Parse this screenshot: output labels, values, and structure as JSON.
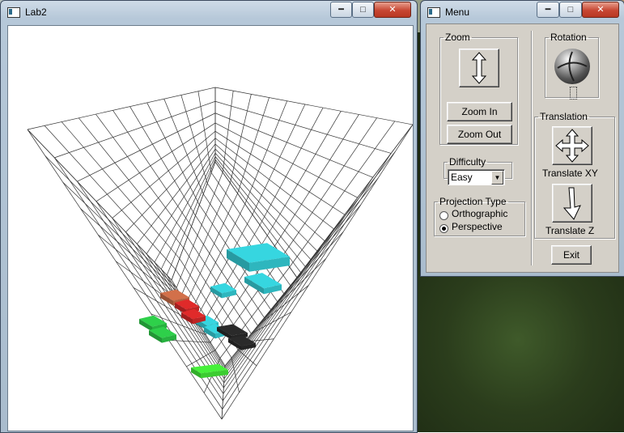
{
  "lab2_window": {
    "title": "Lab2"
  },
  "menu_window": {
    "title": "Menu",
    "zoom": {
      "legend": "Zoom",
      "zoom_in": "Zoom In",
      "zoom_out": "Zoom Out"
    },
    "difficulty": {
      "legend": "Difficulty",
      "selected": "Easy"
    },
    "projection": {
      "legend": "Projection Type",
      "options": [
        "Orthographic",
        "Perspective"
      ],
      "selected": "Perspective"
    },
    "rotation": {
      "legend": "Rotation"
    },
    "translation": {
      "legend": "Translation",
      "translate_xy": "Translate XY",
      "translate_z": "Translate Z"
    },
    "exit": "Exit"
  },
  "pit": {
    "width": 11,
    "depth": 11,
    "piece_colors": [
      "#36d6e0",
      "#d2704a",
      "#e02a2a",
      "#2ed04a",
      "#2a2a2a",
      "#46f03a"
    ]
  },
  "icons": [
    "window-minimize-icon",
    "window-maximize-icon",
    "window-close-icon",
    "vertical-arrow-icon",
    "move-arrows-icon",
    "depth-arrow-icon",
    "rotation-sphere-icon"
  ]
}
